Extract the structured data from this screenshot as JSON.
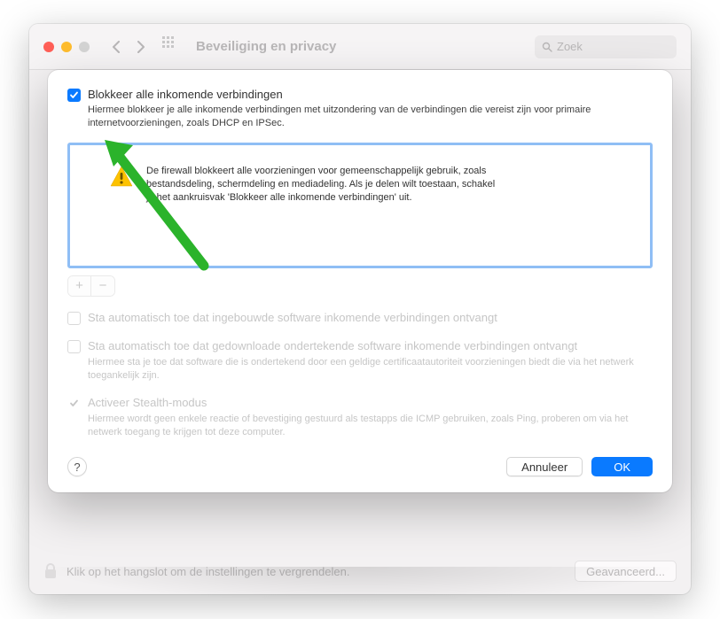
{
  "window": {
    "title": "Beveiliging en privacy",
    "search_placeholder": "Zoek",
    "lock_text": "Klik op het hangslot om de instellingen te vergrendelen.",
    "advanced_button": "Geavanceerd..."
  },
  "modal": {
    "block_incoming": {
      "label": "Blokkeer alle inkomende verbindingen",
      "description": "Hiermee blokkeer je alle inkomende verbindingen met uitzondering van de verbindingen die vereist zijn voor primaire internetvoorzieningen, zoals DHCP en IPSec."
    },
    "info_text": "De firewall blokkeert alle voorzieningen voor gemeenschappelijk gebruik, zoals bestandsdeling, schermdeling en mediadeling. Als je delen wilt toestaan, schakel je het aankruisvak 'Blokkeer alle inkomende verbindingen' uit.",
    "auto_builtin": {
      "label": "Sta automatisch toe dat ingebouwde software inkomende verbindingen ontvangt"
    },
    "auto_signed": {
      "label": "Sta automatisch toe dat gedownloade ondertekende software inkomende verbindingen ontvangt",
      "description": "Hiermee sta je toe dat software die is ondertekend door een geldige certificaatautoriteit voorzieningen biedt die via het netwerk toegankelijk zijn."
    },
    "stealth": {
      "label": "Activeer Stealth-modus",
      "description": "Hiermee wordt geen enkele reactie of bevestiging gestuurd als testapps die ICMP gebruiken, zoals Ping, proberen om via het netwerk toegang te krijgen tot deze computer."
    },
    "help": "?",
    "cancel": "Annuleer",
    "ok": "OK"
  }
}
